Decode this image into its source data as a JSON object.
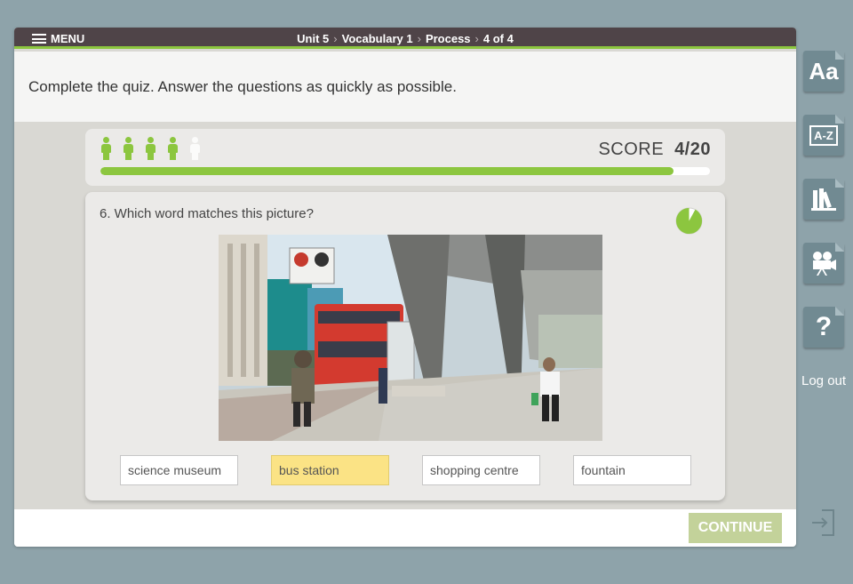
{
  "nav": {
    "menu_label": "MENU",
    "breadcrumb": [
      "Unit 5",
      "Vocabulary 1",
      "Process",
      "4 of 4"
    ]
  },
  "instruction": "Complete the quiz. Answer the questions as quickly as possible.",
  "score": {
    "label": "SCORE",
    "value": "4/20",
    "progress_fraction": 0.94,
    "lives": [
      "green",
      "green",
      "green",
      "green",
      "grey"
    ]
  },
  "question": {
    "text": "6. Which word matches this picture?",
    "timer_fraction_remaining": 0.92,
    "image_icon": "bus-station-photo",
    "options": [
      {
        "label": "science museum",
        "selected": false
      },
      {
        "label": "bus station",
        "selected": true
      },
      {
        "label": "shopping centre",
        "selected": false
      },
      {
        "label": "fountain",
        "selected": false
      }
    ]
  },
  "footer": {
    "continue_label": "CONTINUE"
  },
  "sidebar": {
    "font_icon_text": "Aa",
    "glossary_icon_text": "A-Z",
    "help_icon_text": "?",
    "logout_label": "Log out"
  },
  "colors": {
    "accent_green": "#8cc63f",
    "topbar": "#4f4448",
    "selected_option": "#fbe385",
    "continue_disabled": "#c3d29a",
    "sidebar_button": "#718a92"
  }
}
